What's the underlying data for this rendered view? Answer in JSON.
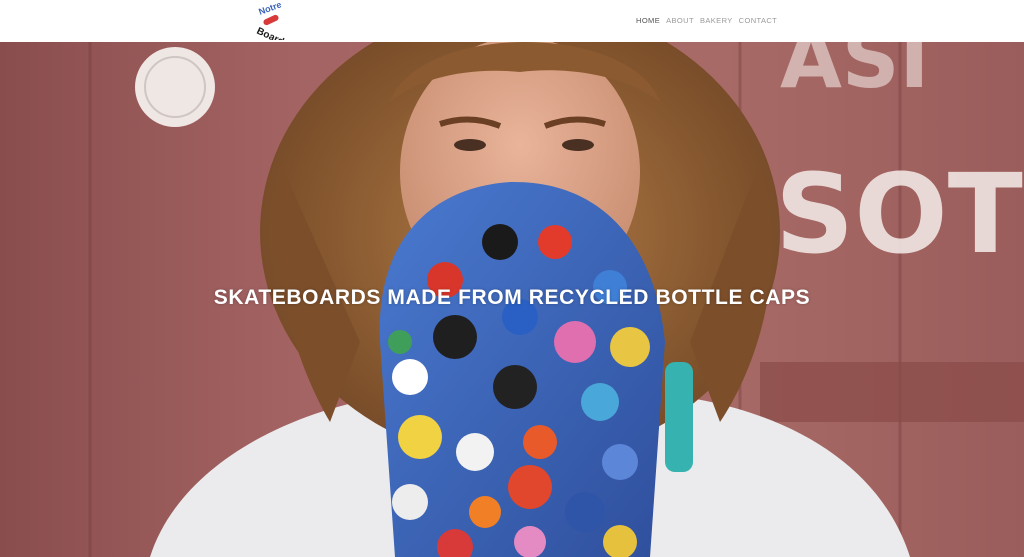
{
  "brand": {
    "logo_alt": "Notre Boards",
    "logo_letters": [
      "N",
      "o",
      "t",
      "r",
      "e",
      "B",
      "o",
      "a",
      "r",
      "d",
      "s"
    ]
  },
  "nav": {
    "items": [
      {
        "label": "HOME",
        "active": true
      },
      {
        "label": "ABOUT",
        "active": false
      },
      {
        "label": "BAKERY",
        "active": false
      },
      {
        "label": "CONTACT",
        "active": false
      }
    ]
  },
  "hero": {
    "headline": "SKATEBOARDS MADE FROM RECYCLED BOTTLE CAPS",
    "wall_stencil_text": [
      "ASI",
      "SOT"
    ],
    "image_description_icon": "hero-photo"
  },
  "colors": {
    "wall": "#9e5c5c",
    "board": "#3a63b8",
    "hair": "#8a5a2e",
    "shirt": "#e9e9ea",
    "nav_active": "#555555",
    "nav_inactive": "#9a9a9a"
  }
}
